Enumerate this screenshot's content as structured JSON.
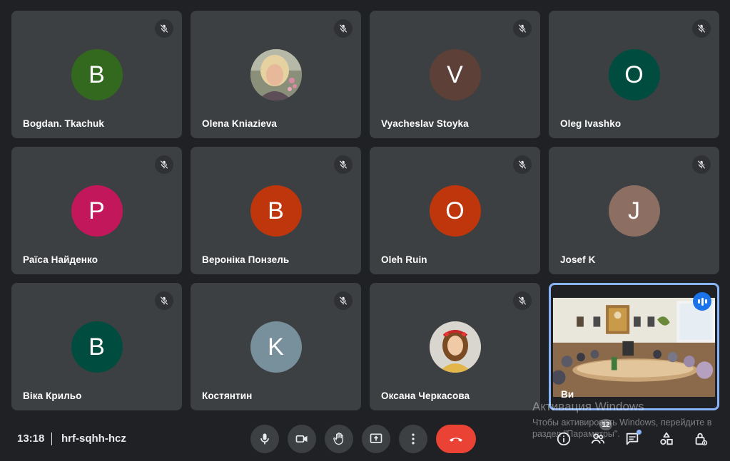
{
  "colors": {
    "background": "#202124",
    "tile": "#3c4043",
    "active_border": "#8ab4f8",
    "speaking": "#1a73e8",
    "end_call": "#ea4335"
  },
  "participants": [
    {
      "name": "Bogdan. Tkachuk",
      "initial": "B",
      "avatar_color": "#33691e",
      "muted": true
    },
    {
      "name": "Olena Kniazieva",
      "initial": "",
      "avatar_color": "#b0a08a",
      "muted": true,
      "photo": "woman-blonde-photo"
    },
    {
      "name": "Vyacheslav Stoyka",
      "initial": "V",
      "avatar_color": "#5d4037",
      "muted": true
    },
    {
      "name": "Oleg Ivashko",
      "initial": "O",
      "avatar_color": "#004d40",
      "muted": true
    },
    {
      "name": "Раїса Найденко",
      "initial": "P",
      "avatar_color": "#c2185b",
      "muted": true
    },
    {
      "name": "Вероніка Понзель",
      "initial": "B",
      "avatar_color": "#bf360c",
      "muted": true
    },
    {
      "name": "Oleh Ruin",
      "initial": "O",
      "avatar_color": "#bf360c",
      "muted": true
    },
    {
      "name": "Josef K",
      "initial": "J",
      "avatar_color": "#8d6e63",
      "muted": true
    },
    {
      "name": "Віка Крильо",
      "initial": "B",
      "avatar_color": "#004d40",
      "muted": true
    },
    {
      "name": "Костянтин",
      "initial": "K",
      "avatar_color": "#78909c",
      "muted": true
    },
    {
      "name": "Оксана Черкасова",
      "initial": "",
      "avatar_color": "#8a6a3a",
      "muted": true,
      "photo": "woman-wreath-photo"
    },
    {
      "name": "Ви",
      "initial": "",
      "muted": false,
      "video": "conference-room-video",
      "speaking": true
    }
  ],
  "bottom": {
    "time": "13:18",
    "meeting_code": "hrf-sqhh-hcz",
    "people_count": "12"
  },
  "icons": {
    "mute": "mic-off-icon",
    "mic": "mic-icon",
    "camera": "camera-icon",
    "hand": "raise-hand-icon",
    "present": "present-screen-icon",
    "more": "more-vert-icon",
    "end": "call-end-icon",
    "info": "info-icon",
    "people": "people-icon",
    "chat": "chat-icon",
    "activities": "activities-icon",
    "host": "host-controls-icon"
  },
  "watermark": {
    "title": "Активация Windows",
    "text": "Чтобы активировать Windows, перейдите в раздел \"Параметры\"."
  }
}
